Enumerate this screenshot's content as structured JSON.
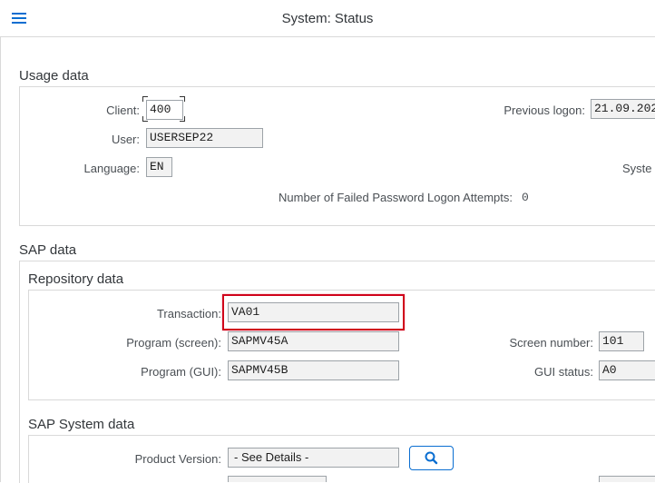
{
  "header": {
    "title": "System: Status",
    "menu_icon": "hamburger-menu-icon"
  },
  "usage_data": {
    "title": "Usage data",
    "client_label": "Client:",
    "client_value": "400",
    "user_label": "User:",
    "user_value": "USERSEP22",
    "language_label": "Language:",
    "language_value": "EN",
    "previous_logon_label": "Previous logon:",
    "previous_logon_value": "21.09.202",
    "system_label": "Syste",
    "failed_attempts_label": "Number of Failed Password Logon Attempts:",
    "failed_attempts_value": "0"
  },
  "sap_data": {
    "title": "SAP data",
    "repository": {
      "title": "Repository data",
      "transaction_label": "Transaction:",
      "transaction_value": "VA01",
      "program_screen_label": "Program (screen):",
      "program_screen_value": "SAPMV45A",
      "program_gui_label": "Program (GUI):",
      "program_gui_value": "SAPMV45B",
      "screen_number_label": "Screen number:",
      "screen_number_value": "101",
      "gui_status_label": "GUI status:",
      "gui_status_value": "A0"
    },
    "system": {
      "title": "SAP System data",
      "product_version_label": "Product Version:",
      "product_version_value": "- See Details -",
      "details_icon": "magnifier-icon"
    }
  },
  "colors": {
    "accent": "#0a6ed1",
    "highlight": "#d0021b",
    "field_bg": "#f2f2f2",
    "border": "#d9d9d9"
  }
}
